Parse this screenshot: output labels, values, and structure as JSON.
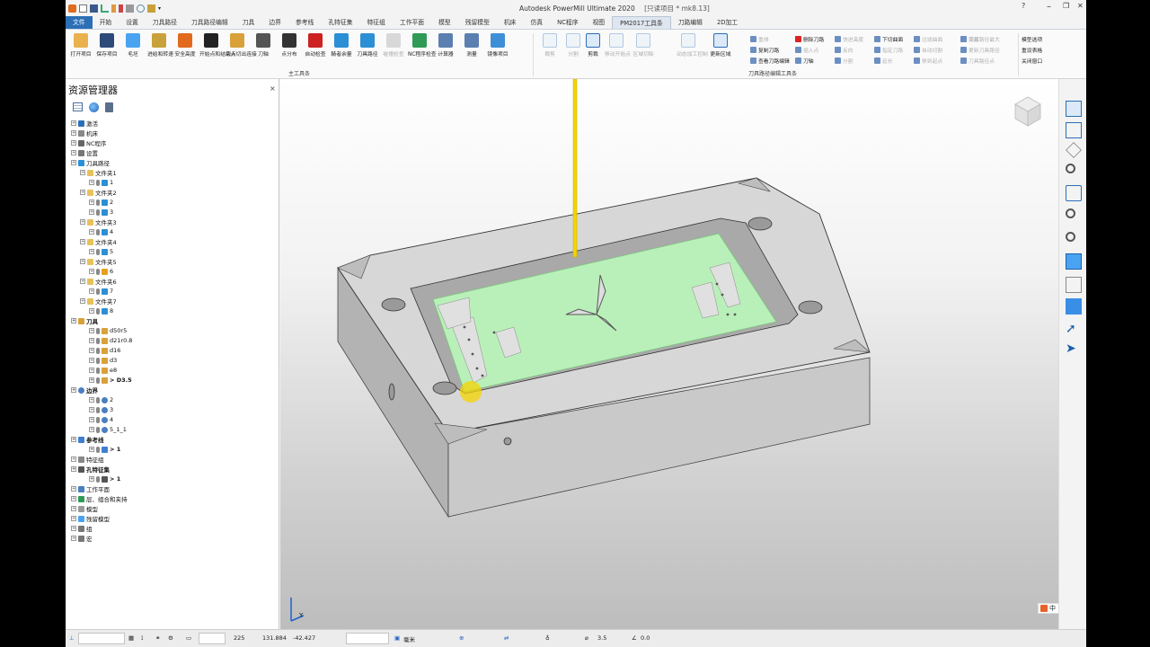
{
  "window": {
    "app_title": "Autodesk PowerMill Ultimate 2020",
    "project": "[只读项目 * mk8.13]",
    "help_icon": "help-icon"
  },
  "tabs": [
    "文件",
    "开始",
    "设置",
    "刀具路径",
    "刀具路径编辑",
    "刀具",
    "边界",
    "参考线",
    "孔特征集",
    "特征组",
    "工作平面",
    "模型",
    "残留模型",
    "机床",
    "仿真",
    "NC程序",
    "视图",
    "PM2017工具条",
    "刀路编辑",
    "2D加工"
  ],
  "ribbon": {
    "main_buttons": [
      "打开项目",
      "保存项目",
      "毛坯",
      "进给和转速",
      "安全高度",
      "开始点和结束点",
      "切入切出连接",
      "刀轴",
      "点分布",
      "自动检查",
      "騎者余量",
      "刀具路径",
      "碰撞检查",
      "NC程序检查",
      "计算器",
      "测量",
      "镜像项目"
    ],
    "main_group_label": "主工具条",
    "edit_buttons": [
      "裁剪",
      "分割",
      "剪裁",
      "移动开始点",
      "区域切除",
      "动态加工控制",
      "更新区域"
    ],
    "edit_small": [
      "重排",
      "复制刀路",
      "查看刀路编辑",
      "删除刀路",
      "插入点",
      "刀轴",
      "快进高度",
      "反向",
      "分割",
      "下切曲面",
      "指定刀路",
      "延长",
      "过滤曲面",
      "自动切割",
      "移到起点",
      "保留",
      "更新刀具路径",
      "刀具路径点",
      "刀具路径最大"
    ],
    "edit_group_label": "刀具路径编辑工具条",
    "right_small": [
      "模型选项",
      "重设表格",
      "关闭窗口"
    ]
  },
  "explorer": {
    "title": "资源管理器",
    "close": "×",
    "tree": [
      {
        "label": "激活",
        "level": 0,
        "icon": "activate"
      },
      {
        "label": "机床",
        "level": 0,
        "icon": "machine"
      },
      {
        "label": "NC程序",
        "level": 0,
        "icon": "nc"
      },
      {
        "label": "设置",
        "level": 0,
        "icon": "setup"
      },
      {
        "label": "刀具路径",
        "level": 0,
        "icon": "toolpath"
      },
      {
        "label": "文件夹1",
        "level": 1,
        "icon": "folder"
      },
      {
        "label": "1",
        "level": 2,
        "icon": "tp",
        "active": true
      },
      {
        "label": "文件夹2",
        "level": 1,
        "icon": "folder"
      },
      {
        "label": "2",
        "level": 2,
        "icon": "tp"
      },
      {
        "label": "3",
        "level": 2,
        "icon": "tp"
      },
      {
        "label": "文件夹3",
        "level": 1,
        "icon": "folder"
      },
      {
        "label": "4",
        "level": 2,
        "icon": "tp"
      },
      {
        "label": "文件夹4",
        "level": 1,
        "icon": "folder"
      },
      {
        "label": "5",
        "level": 2,
        "icon": "tp"
      },
      {
        "label": "文件夹5",
        "level": 1,
        "icon": "folder"
      },
      {
        "label": "6",
        "level": 2,
        "icon": "tpw"
      },
      {
        "label": "文件夹6",
        "level": 1,
        "icon": "folder"
      },
      {
        "label": "7",
        "level": 2,
        "icon": "tp"
      },
      {
        "label": "文件夹7",
        "level": 1,
        "icon": "folder"
      },
      {
        "label": "8",
        "level": 2,
        "icon": "tp"
      },
      {
        "label": "刀具",
        "level": 0,
        "icon": "tool",
        "bold": true
      },
      {
        "label": "d50r5",
        "level": 2,
        "icon": "tool"
      },
      {
        "label": "d21r0.8",
        "level": 2,
        "icon": "tool"
      },
      {
        "label": "d16",
        "level": 2,
        "icon": "tool"
      },
      {
        "label": "d3",
        "level": 2,
        "icon": "tool"
      },
      {
        "label": "e8",
        "level": 2,
        "icon": "tool"
      },
      {
        "label": "> D3.5",
        "level": 2,
        "icon": "tool",
        "bold": true
      },
      {
        "label": "边界",
        "level": 0,
        "icon": "boundary",
        "bold": true
      },
      {
        "label": "2",
        "level": 2,
        "icon": "boundary"
      },
      {
        "label": "3",
        "level": 2,
        "icon": "boundary"
      },
      {
        "label": "4",
        "level": 2,
        "icon": "boundary"
      },
      {
        "label": "5_1_1",
        "level": 2,
        "icon": "boundary"
      },
      {
        "label": "参考线",
        "level": 0,
        "icon": "pattern",
        "bold": true
      },
      {
        "label": "> 1",
        "level": 2,
        "icon": "pattern",
        "bold": true
      },
      {
        "label": "特征组",
        "level": 0,
        "icon": "feature"
      },
      {
        "label": "孔特征集",
        "level": 0,
        "icon": "holes",
        "bold": true
      },
      {
        "label": "> 1",
        "level": 2,
        "icon": "holes",
        "bold": true
      },
      {
        "label": "工作平面",
        "level": 0,
        "icon": "workplane"
      },
      {
        "label": "层、组合和夹持",
        "level": 0,
        "icon": "layers"
      },
      {
        "label": "模型",
        "level": 0,
        "icon": "model"
      },
      {
        "label": "残留模型",
        "level": 0,
        "icon": "stock"
      },
      {
        "label": "组",
        "level": 0,
        "icon": "group"
      },
      {
        "label": "宏",
        "level": 0,
        "icon": "macro"
      }
    ]
  },
  "viewport": {
    "axis_label": "Y",
    "ime_label": "中"
  },
  "status": {
    "v1": "225",
    "x": "131.884",
    "y": "-42.427",
    "unit": "毫米",
    "diameter": "3.5",
    "offset": "0.0"
  },
  "colors": {
    "accent": "#2b6fb6",
    "toolpath_green": "#b9f0b9",
    "tool_yellow": "#f3d400",
    "part_grey": "#c9c9c9"
  }
}
